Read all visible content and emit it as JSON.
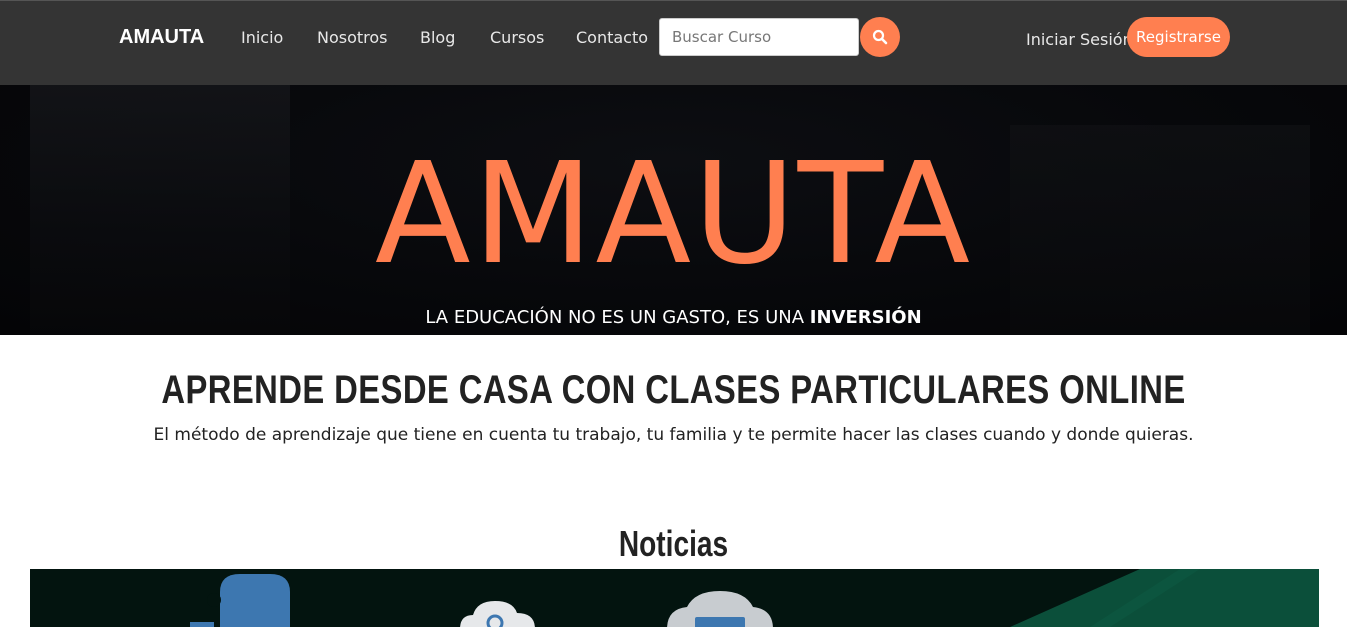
{
  "navbar": {
    "brand": "AMAUTA",
    "links": [
      "Inicio",
      "Nosotros",
      "Blog",
      "Cursos",
      "Contacto"
    ],
    "search": {
      "placeholder": "Buscar Curso",
      "value": ""
    },
    "login_label": "Iniciar Sesión",
    "register_label": "Registrarse",
    "accent_color": "#ff7f50",
    "background_color": "#343434"
  },
  "hero": {
    "title": "AMAUTA",
    "subtitle_prefix": "LA EDUCACIÓN NO ES UN GASTO, ES UNA ",
    "subtitle_bold": "INVERSIÓN"
  },
  "intro": {
    "title": "APRENDE DESDE CASA CON CLASES PARTICULARES ONLINE",
    "text": "El método de aprendizaje que tiene en cuenta tu trabajo, tu familia y te permite hacer las clases cuando y donde quieras."
  },
  "news": {
    "title": "Noticias",
    "banner_icons": [
      "python-logo-icon",
      "cloud-gear-icon",
      "cloud-computer-icon"
    ]
  }
}
